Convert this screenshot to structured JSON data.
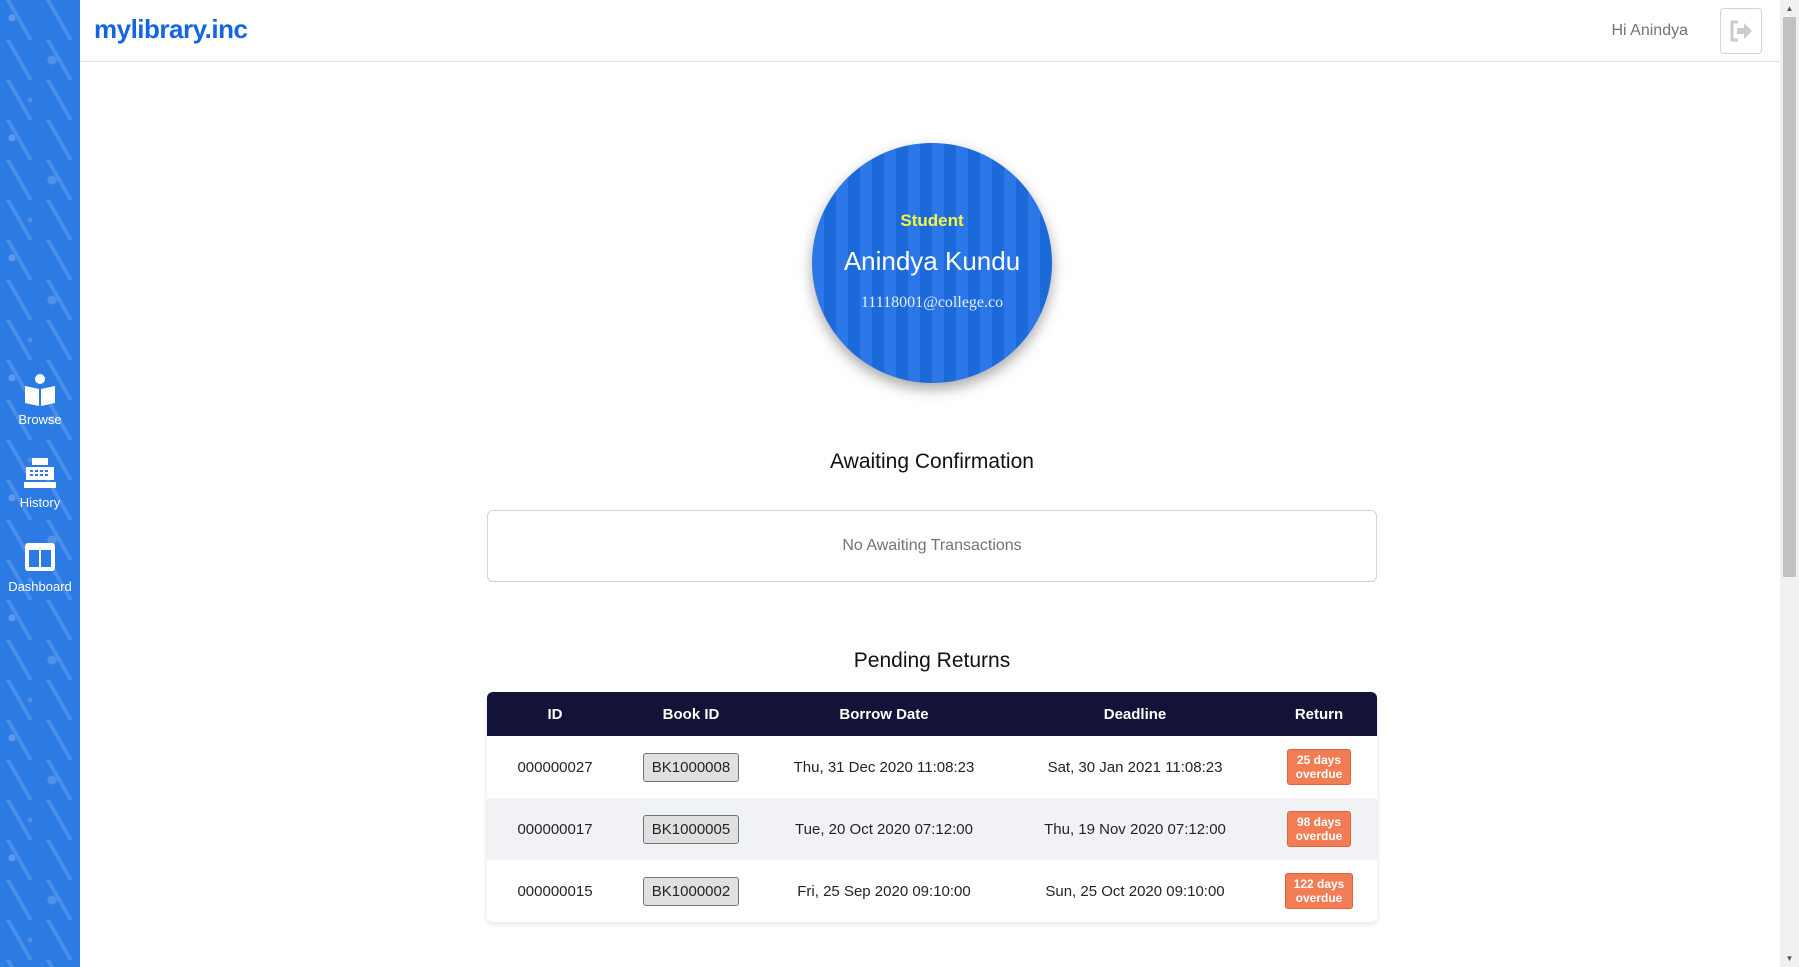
{
  "header": {
    "brand": "mylibrary.inc",
    "greeting": "Hi Anindya"
  },
  "sidebar": {
    "items": [
      {
        "label": "Browse",
        "icon": "book-icon"
      },
      {
        "label": "History",
        "icon": "register-icon"
      },
      {
        "label": "Dashboard",
        "icon": "dashboard-icon"
      }
    ]
  },
  "profile": {
    "role": "Student",
    "name": "Anindya Kundu",
    "email": "11118001@college.co"
  },
  "awaiting": {
    "title": "Awaiting Confirmation",
    "empty_text": "No Awaiting Transactions"
  },
  "pending": {
    "title": "Pending Returns",
    "columns": [
      "ID",
      "Book ID",
      "Borrow Date",
      "Deadline",
      "Return"
    ],
    "rows": [
      {
        "id": "000000027",
        "book_id": "BK1000008",
        "borrow_date": "Thu, 31 Dec 2020 11:08:23",
        "deadline": "Sat, 30 Jan 2021 11:08:23",
        "return_line1": "25 days",
        "return_line2": "overdue"
      },
      {
        "id": "000000017",
        "book_id": "BK1000005",
        "borrow_date": "Tue, 20 Oct 2020 07:12:00",
        "deadline": "Thu, 19 Nov 2020 07:12:00",
        "return_line1": "98 days",
        "return_line2": "overdue"
      },
      {
        "id": "000000015",
        "book_id": "BK1000002",
        "borrow_date": "Fri, 25 Sep 2020 09:10:00",
        "deadline": "Sun, 25 Oct 2020 09:10:00",
        "return_line1": "122 days",
        "return_line2": "overdue"
      }
    ]
  },
  "colors": {
    "sidebar": "#2c7be5",
    "brand": "#1565e0",
    "table_header": "#131339",
    "overdue": "#f27d55",
    "role": "#f5f542"
  }
}
